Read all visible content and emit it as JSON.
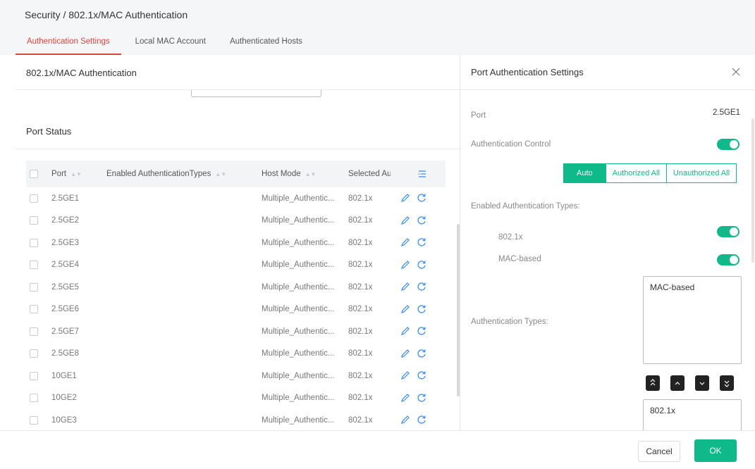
{
  "breadcrumb": "Security / 802.1x/MAC Authentication",
  "tabs": [
    {
      "label": "Authentication Settings",
      "active": true
    },
    {
      "label": "Local MAC Account",
      "active": false
    },
    {
      "label": "Authenticated Hosts",
      "active": false
    }
  ],
  "left_panel": {
    "title": "802.1x/MAC Authentication",
    "section_title": "Port Status"
  },
  "table": {
    "headers": {
      "port": "Port",
      "enabled": "Enabled AuthenticationTypes",
      "host_mode": "Host Mode",
      "selected": "Selected Au"
    },
    "rows": [
      {
        "port": "2.5GE1",
        "host_mode": "Multiple_Authentic...",
        "selected": "802.1x"
      },
      {
        "port": "2.5GE2",
        "host_mode": "Multiple_Authentic...",
        "selected": "802.1x"
      },
      {
        "port": "2.5GE3",
        "host_mode": "Multiple_Authentic...",
        "selected": "802.1x"
      },
      {
        "port": "2.5GE4",
        "host_mode": "Multiple_Authentic...",
        "selected": "802.1x"
      },
      {
        "port": "2.5GE5",
        "host_mode": "Multiple_Authentic...",
        "selected": "802.1x"
      },
      {
        "port": "2.5GE6",
        "host_mode": "Multiple_Authentic...",
        "selected": "802.1x"
      },
      {
        "port": "2.5GE7",
        "host_mode": "Multiple_Authentic...",
        "selected": "802.1x"
      },
      {
        "port": "2.5GE8",
        "host_mode": "Multiple_Authentic...",
        "selected": "802.1x"
      },
      {
        "port": "10GE1",
        "host_mode": "Multiple_Authentic...",
        "selected": "802.1x"
      },
      {
        "port": "10GE2",
        "host_mode": "Multiple_Authentic...",
        "selected": "802.1x"
      },
      {
        "port": "10GE3",
        "host_mode": "Multiple_Authentic...",
        "selected": "802.1x"
      }
    ]
  },
  "right_panel": {
    "title": "Port Authentication Settings",
    "port_label": "Port",
    "port_value": "2.5GE1",
    "auth_control_label": "Authentication Control",
    "auth_control_on": true,
    "segment": {
      "auto": "Auto",
      "authorized": "Authorized All",
      "unauthorized": "Unauthorized All",
      "selected": "Auto"
    },
    "enabled_types_label": "Enabled Authentication Types:",
    "type_8021x_label": "802.1x",
    "type_8021x_on": true,
    "type_mac_label": "MAC-based",
    "type_mac_on": true,
    "auth_types_label": "Authentication Types:",
    "list_top": [
      "MAC-based"
    ],
    "list_bottom": [
      "802.1x"
    ]
  },
  "footer": {
    "cancel": "Cancel",
    "ok": "OK"
  },
  "colors": {
    "accent": "#0fb98a",
    "tab_active": "#e0443f",
    "icon_blue": "#3b8ff0"
  },
  "icons": [
    "edit-icon",
    "refresh-icon",
    "column-settings-icon",
    "close-icon",
    "move-top-icon",
    "move-up-icon",
    "move-down-icon",
    "move-bottom-icon",
    "sort-icon"
  ]
}
